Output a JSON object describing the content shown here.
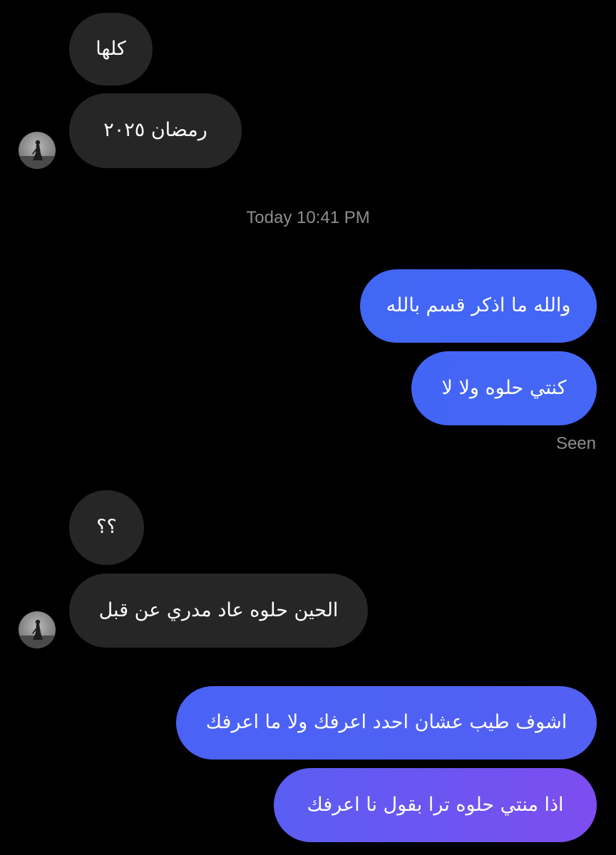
{
  "thread": {
    "timestamp": "Today 10:41 PM",
    "seen_label": "Seen",
    "colors": {
      "received_bubble": "#262626",
      "sent_gradient_start": "#3f6cf6",
      "sent_gradient_end": "#7d4cf0",
      "meta_text": "#8e8e8e",
      "background": "#000000"
    },
    "messages": [
      {
        "sender": "other",
        "text": "كلها"
      },
      {
        "sender": "other",
        "text": "رمضان ٢٠٢٥"
      },
      {
        "sender": "me",
        "text": "والله ما اذكر قسم بالله"
      },
      {
        "sender": "me",
        "text": "كنتي حلوه ولا لا"
      },
      {
        "sender": "other",
        "text": "؟؟"
      },
      {
        "sender": "other",
        "text": "الحين حلوه عاد مدري عن قبل"
      },
      {
        "sender": "me",
        "text": "اشوف طيب عشان احدد اعرفك ولا ما اعرفك"
      },
      {
        "sender": "me",
        "text": "اذا منتي حلوه ترا بقول نا اعرفك"
      }
    ],
    "avatar_icon": "person-silhouette-icon"
  }
}
